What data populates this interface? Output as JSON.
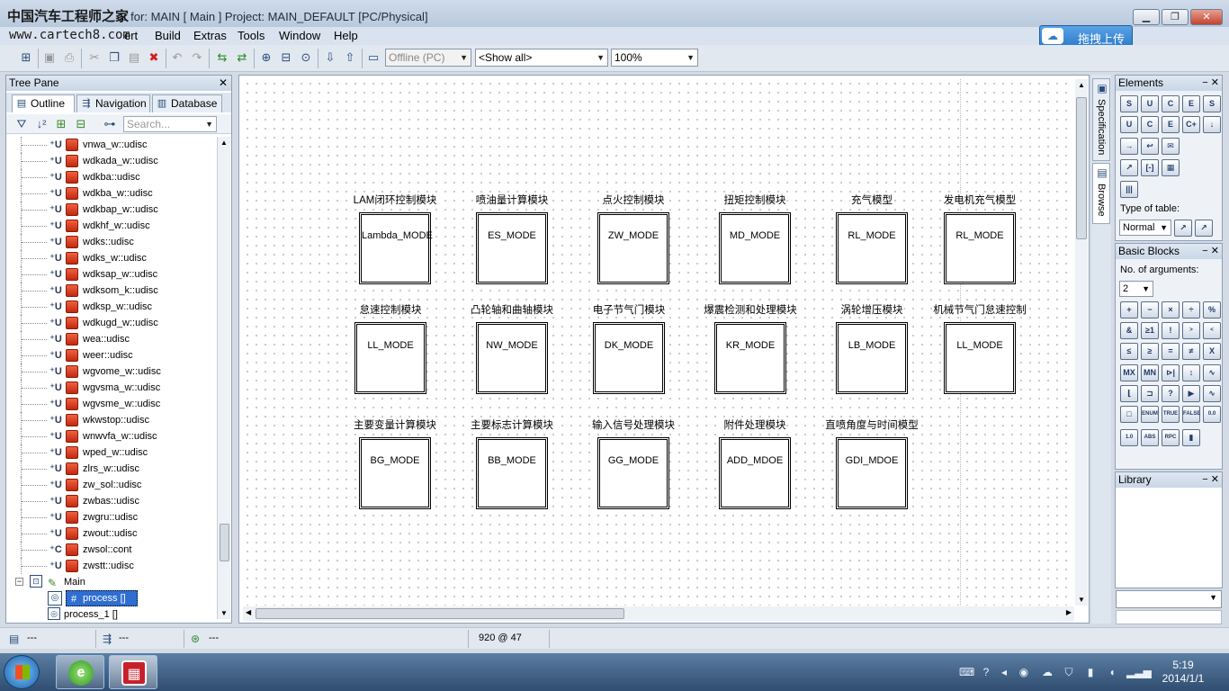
{
  "watermark": {
    "cn": "中国汽车工程师之家",
    "url": "www.cartech8.com"
  },
  "window": {
    "title": "or for: MAIN [ Main ] Project: MAIN_DEFAULT [PC/Physical]"
  },
  "menu": [
    "ert",
    "Build",
    "Extras",
    "Tools",
    "Window",
    "Help"
  ],
  "upload": {
    "label": "拖拽上传"
  },
  "toolbar": {
    "offline_value": "Offline (PC)",
    "show_value": "<Show all>",
    "zoom_value": "100%"
  },
  "tree": {
    "header": "Tree Pane",
    "tabs": [
      "Outline",
      "Navigation",
      "Database"
    ],
    "search_placeholder": "Search...",
    "items": [
      {
        "type": "U",
        "label": "vnwa_w::udisc"
      },
      {
        "type": "U",
        "label": "wdkada_w::udisc"
      },
      {
        "type": "U",
        "label": "wdkba::udisc"
      },
      {
        "type": "U",
        "label": "wdkba_w::udisc"
      },
      {
        "type": "U",
        "label": "wdkbap_w::udisc"
      },
      {
        "type": "U",
        "label": "wdkhf_w::udisc"
      },
      {
        "type": "U",
        "label": "wdks::udisc"
      },
      {
        "type": "U",
        "label": "wdks_w::udisc"
      },
      {
        "type": "U",
        "label": "wdksap_w::udisc"
      },
      {
        "type": "U",
        "label": "wdksom_k::udisc"
      },
      {
        "type": "U",
        "label": "wdksp_w::udisc"
      },
      {
        "type": "U",
        "label": "wdkugd_w::udisc"
      },
      {
        "type": "U",
        "label": "wea::udisc"
      },
      {
        "type": "U",
        "label": "weer::udisc"
      },
      {
        "type": "U",
        "label": "wgvome_w::udisc"
      },
      {
        "type": "U",
        "label": "wgvsma_w::udisc"
      },
      {
        "type": "U",
        "label": "wgvsme_w::udisc"
      },
      {
        "type": "U",
        "label": "wkwstop::udisc"
      },
      {
        "type": "U",
        "label": "wnwvfa_w::udisc"
      },
      {
        "type": "U",
        "label": "wped_w::udisc"
      },
      {
        "type": "U",
        "label": "zlrs_w::udisc"
      },
      {
        "type": "U",
        "label": "zw_sol::udisc"
      },
      {
        "type": "U",
        "label": "zwbas::udisc"
      },
      {
        "type": "U",
        "label": "zwgru::udisc"
      },
      {
        "type": "U",
        "label": "zwout::udisc"
      },
      {
        "type": "C",
        "label": "zwsol::cont"
      },
      {
        "type": "U",
        "label": "zwstt::udisc"
      }
    ],
    "main_label": "Main",
    "process_selected": "process []",
    "process_other": "process_1 []"
  },
  "modules": [
    {
      "title": "LAM闭环控制模块",
      "label": "Lambda_MODE"
    },
    {
      "title": "喷油量计算模块",
      "label": "ES_MODE"
    },
    {
      "title": "点火控制模块",
      "label": "ZW_MODE"
    },
    {
      "title": "扭矩控制模块",
      "label": "MD_MODE"
    },
    {
      "title": "充气模型",
      "label": "RL_MODE"
    },
    {
      "title": "发电机充气模型",
      "label": "RL_MODE"
    },
    {
      "title": "怠速控制模块",
      "label": "LL_MODE"
    },
    {
      "title": "凸轮轴和曲轴模块",
      "label": "NW_MODE"
    },
    {
      "title": "电子节气门模块",
      "label": "DK_MODE"
    },
    {
      "title": "爆震检测和处理模块",
      "label": "KR_MODE"
    },
    {
      "title": "涡轮增压模块",
      "label": "LB_MODE"
    },
    {
      "title": "机械节气门怠速控制",
      "label": "LL_MODE"
    },
    {
      "title": "主要变量计算模块",
      "label": "BG_MODE"
    },
    {
      "title": "主要标志计算模块",
      "label": "BB_MODE"
    },
    {
      "title": "输入信号处理模块",
      "label": "GG_MODE"
    },
    {
      "title": "附件处理模块",
      "label": "ADD_MDOE"
    },
    {
      "title": "直喷角度与时间模型",
      "label": "GDI_MDOE"
    }
  ],
  "side_tabs": [
    "Specification",
    "Browse"
  ],
  "elements_panel": {
    "header": "Elements",
    "buttons": [
      "S",
      "U",
      "C",
      "E",
      "S",
      "U",
      "C",
      "E",
      "C+",
      "↓",
      "→",
      "↩",
      "✉",
      "↗",
      "[-]",
      "▦",
      "|||"
    ],
    "type_of_table_label": "Type of table:",
    "type_of_table_value": "Normal"
  },
  "basic_panel": {
    "header": "Basic Blocks",
    "args_label": "No. of arguments:",
    "args_value": "2",
    "buttons": [
      "+",
      "−",
      "×",
      "÷",
      "%",
      "&",
      "≥1",
      "!",
      "&gt;",
      "&lt;",
      "≤",
      "≥",
      "=",
      "≠",
      "X",
      "MX",
      "MN",
      "⊳|",
      "↕",
      "∿",
      "⌊",
      "⊐",
      "?",
      "▶",
      "∿",
      "□",
      "ENUM",
      "TRUE",
      "FALSE",
      "0.0",
      "1.0",
      "ABS",
      "RPC",
      "▮"
    ]
  },
  "library_panel": {
    "header": "Library"
  },
  "status": {
    "cell1": "---",
    "cell2": "---",
    "cell3": "---",
    "coords": "920 @ 47"
  },
  "taskbar": {
    "time": "5:19",
    "date": "2014/1/1"
  }
}
